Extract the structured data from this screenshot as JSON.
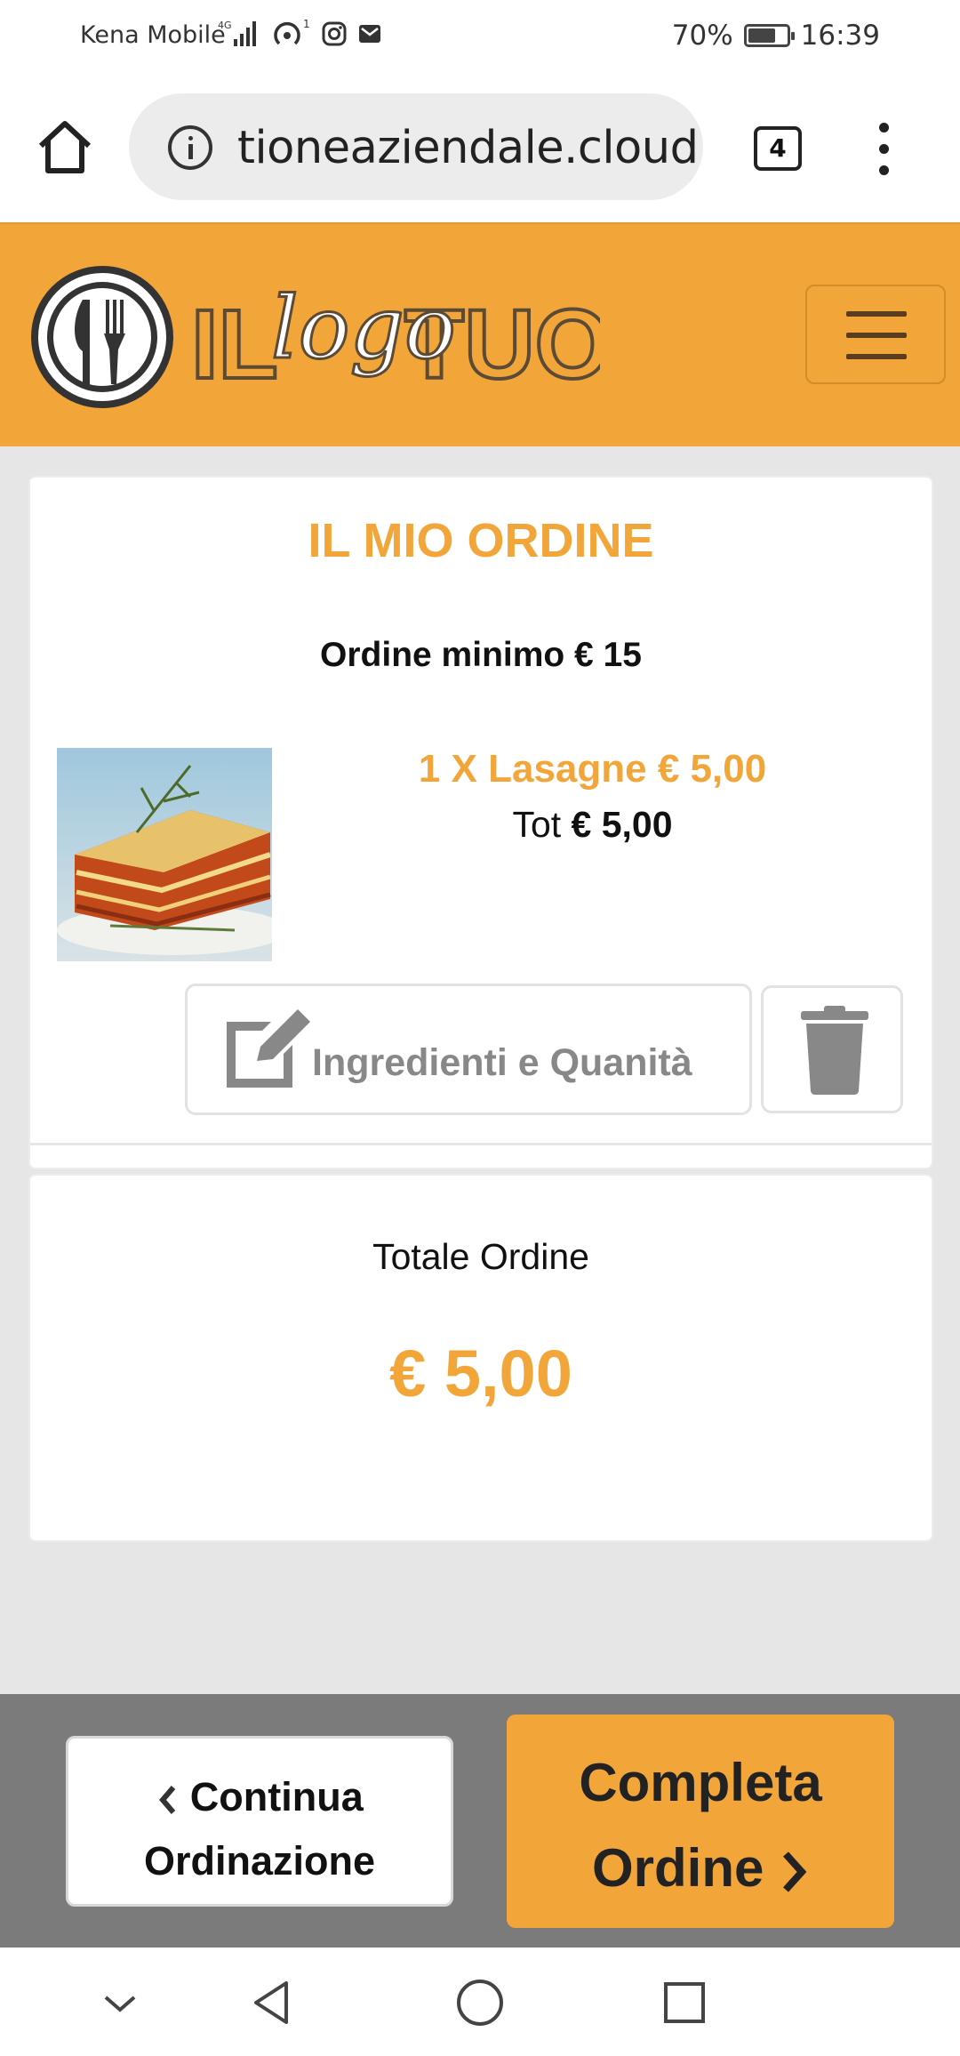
{
  "status_bar": {
    "carrier": "Kena Mobile",
    "network_badge": "4G",
    "hotspot_badge": "1",
    "battery": "70%",
    "battery_level": 0.7,
    "time": "16:39",
    "icons": [
      "signal-icon",
      "hotspot-icon",
      "instagram-icon",
      "mail-icon",
      "battery-icon"
    ]
  },
  "browser": {
    "url": "tioneaziendale.cloud",
    "tab_count": "4",
    "icons": [
      "home-icon",
      "info-icon",
      "tabs-icon",
      "more-icon"
    ]
  },
  "header": {
    "logo_word_1": "IL",
    "logo_word_2": "TUO",
    "logo_script": "logo",
    "menu_icon": "hamburger-icon",
    "colors": {
      "brand_orange": "#f2a63a",
      "menu_line": "#5a3d1e"
    }
  },
  "order": {
    "title": "IL MIO ORDINE",
    "min_order": "Ordine minimo € 15",
    "items": [
      {
        "line": "1 X Lasagne € 5,00",
        "tot_label": "Tot",
        "tot_value": "€ 5,00",
        "edit_label": "Ingredienti e Quanità",
        "edit_icon": "edit-icon",
        "delete_icon": "trash-icon"
      }
    ]
  },
  "total": {
    "label": "Totale Ordine",
    "value": "€ 5,00"
  },
  "actions": {
    "continue_line1": "Continua",
    "continue_line2": "Ordinazione",
    "complete_line1": "Completa",
    "complete_line2": "Ordine"
  },
  "nav_bar": {
    "icons": [
      "collapse-icon",
      "back-icon",
      "home-circle-icon",
      "recents-icon"
    ]
  }
}
